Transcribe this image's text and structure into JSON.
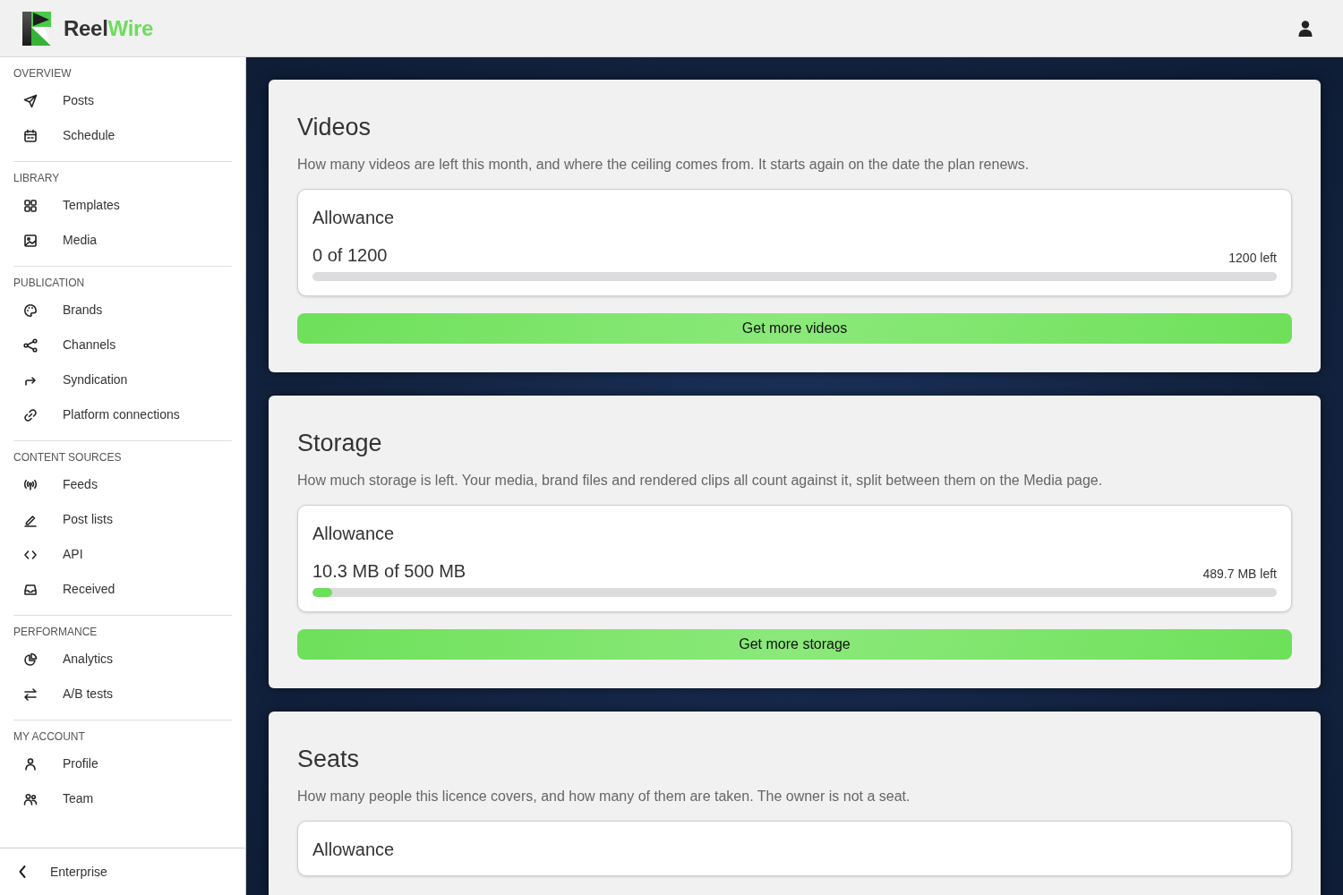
{
  "header": {
    "brand_first": "Reel",
    "brand_second": "Wire"
  },
  "sidebar": {
    "sections": [
      {
        "heading": "OVERVIEW",
        "items": [
          {
            "label": "Posts"
          },
          {
            "label": "Schedule"
          }
        ]
      },
      {
        "heading": "LIBRARY",
        "items": [
          {
            "label": "Templates"
          },
          {
            "label": "Media"
          }
        ]
      },
      {
        "heading": "PUBLICATION",
        "items": [
          {
            "label": "Brands"
          },
          {
            "label": "Channels"
          },
          {
            "label": "Syndication"
          },
          {
            "label": "Platform connections"
          }
        ]
      },
      {
        "heading": "CONTENT SOURCES",
        "items": [
          {
            "label": "Feeds"
          },
          {
            "label": "Post lists"
          },
          {
            "label": "API"
          },
          {
            "label": "Received"
          }
        ]
      },
      {
        "heading": "PERFORMANCE",
        "items": [
          {
            "label": "Analytics"
          },
          {
            "label": "A/B tests"
          }
        ]
      },
      {
        "heading": "MY ACCOUNT",
        "items": [
          {
            "label": "Profile"
          },
          {
            "label": "Team"
          }
        ]
      }
    ],
    "footer": {
      "label": "Enterprise"
    }
  },
  "cards": [
    {
      "title": "Videos",
      "description": "How many videos are left this month, and where the ceiling comes from. It starts again on the date the plan renews.",
      "allowance": {
        "label": "Allowance",
        "used": "0 of 1200",
        "remaining": "1200 left",
        "level": 0
      },
      "button": "Get more videos"
    },
    {
      "title": "Storage",
      "description": "How much storage is left. Your media, brand files and rendered clips all count against it, split between them on the Media page.",
      "allowance": {
        "label": "Allowance",
        "used": "10.3 MB of 500 MB",
        "remaining": "489.7 MB left",
        "level": 0.02
      },
      "button": "Get more storage"
    },
    {
      "title": "Seats",
      "description": "How many people this licence covers, and how many of them are taken. The owner is not a seat.",
      "allowance": {
        "label": "Allowance"
      }
    }
  ]
}
